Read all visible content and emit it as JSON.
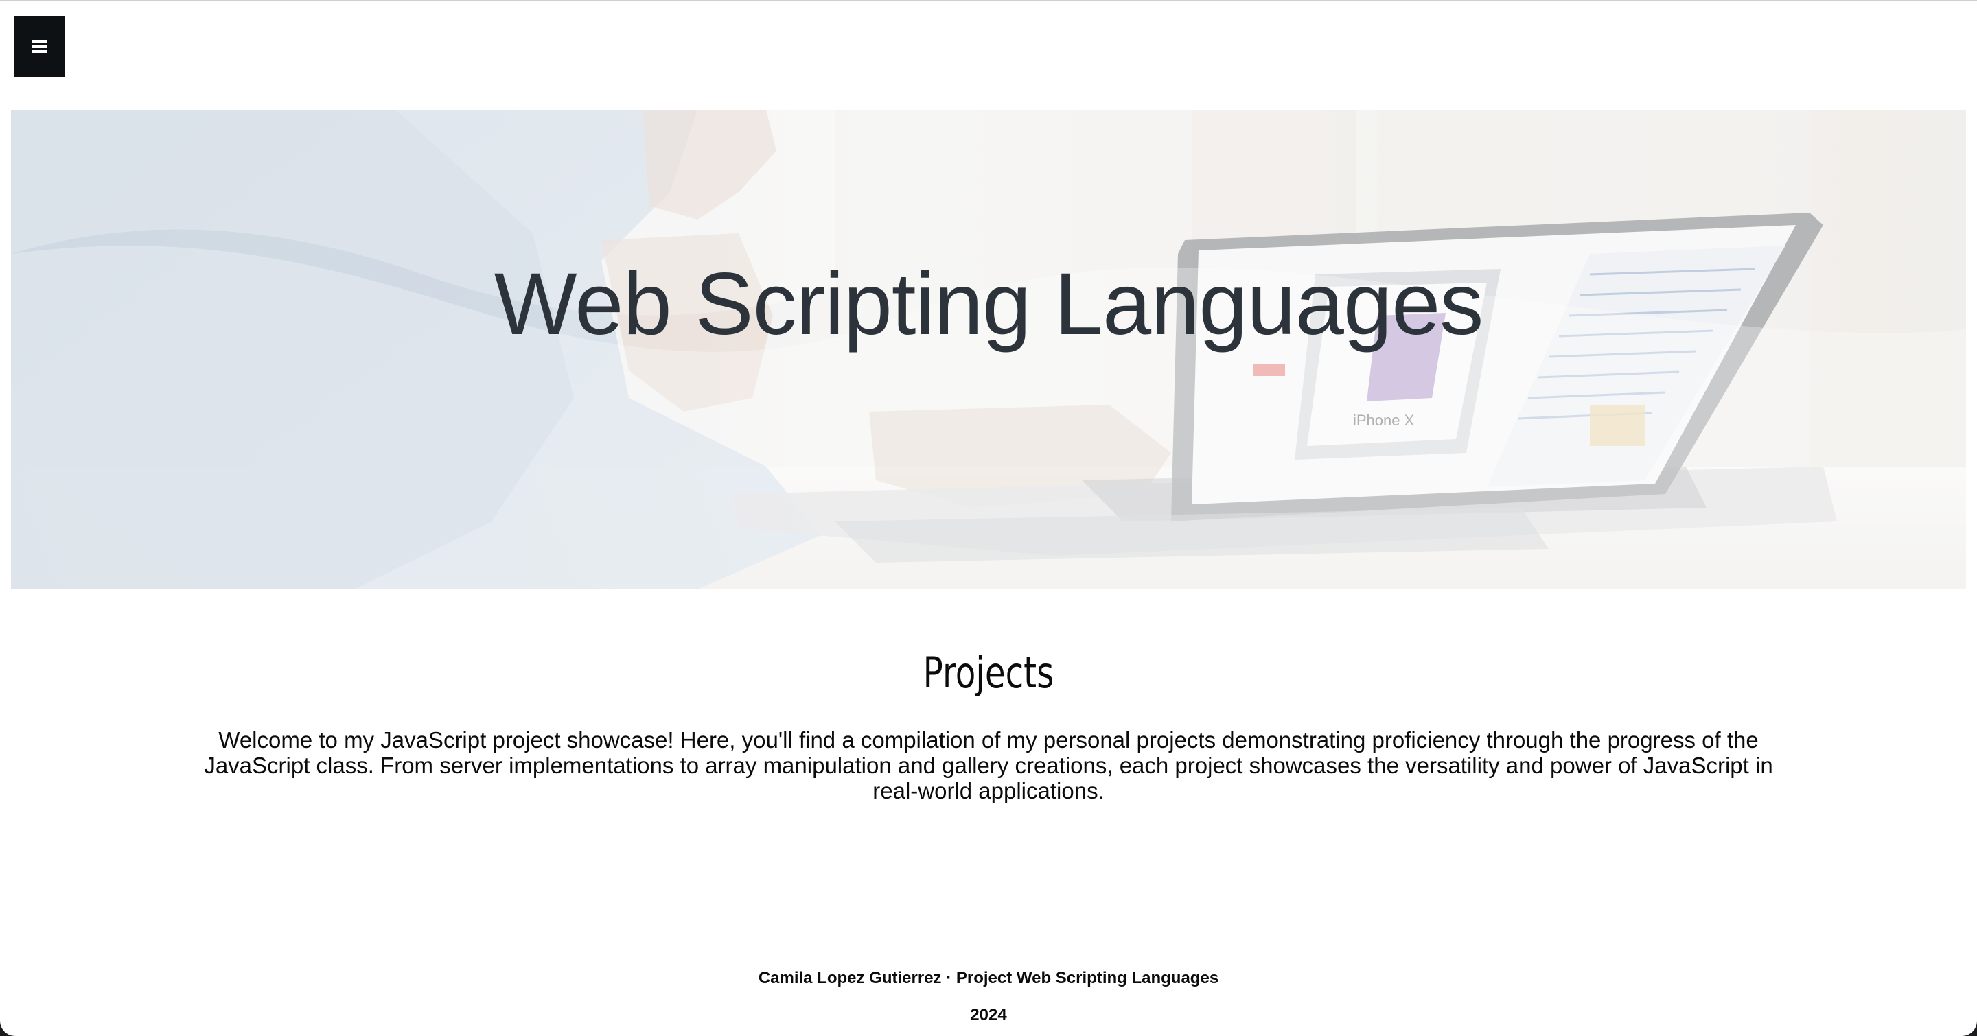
{
  "nav": {
    "menu_icon": "hamburger-menu-icon"
  },
  "hero": {
    "title": "Web Scripting Languages",
    "laptop_screen_caption": "iPhone X"
  },
  "projects": {
    "heading": "Projects",
    "intro": "Welcome to my JavaScript project showcase! Here, you'll find a compilation of my personal projects demonstrating proficiency through the progress of the JavaScript class. From server implementations to array manipulation and gallery creations, each project showcases the versatility and power of JavaScript in real-world applications."
  },
  "footer": {
    "credit": "Camila Lopez Gutierrez · Project Web Scripting Languages",
    "year": "2024"
  },
  "colors": {
    "menu_button_bg": "#0e1114",
    "hero_title": "#2d333b",
    "text": "#0b0b0b"
  }
}
